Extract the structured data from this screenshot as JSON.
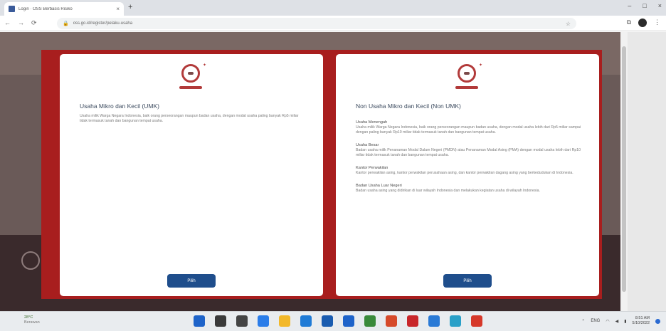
{
  "browser": {
    "tab_title": "Login · OSS Berbasis Risiko",
    "tab_close": "×",
    "new_tab": "+",
    "window_controls": [
      "–",
      "□",
      "×"
    ],
    "nav_controls": [
      "←",
      "→",
      "⟳"
    ],
    "url": "oss.go.id/register/pelaku-usaha",
    "secure_icon": "lock-icon"
  },
  "modal": {
    "left_card": {
      "title": "Usaha Mikro dan Kecil (UMK)",
      "description": "Usaha milik Warga Negara Indonesia, baik orang perseorangan maupun badan usaha, dengan modal usaha paling banyak Rp5 miliar tidak termasuk tanah dan bangunan tempat usaha.",
      "button": "Pilih"
    },
    "right_card": {
      "title": "Non Usaha Mikro dan Kecil (Non UMK)",
      "sections": [
        {
          "title": "Usaha Menengah",
          "text": "Usaha milik Warga Negara Indonesia, baik orang perseorangan maupun badan usaha, dengan modal usaha lebih dari Rp5 miliar sampai dengan paling banyak Rp10 miliar tidak termasuk tanah dan bangunan tempat usaha."
        },
        {
          "title": "Usaha Besar",
          "text": "Badan usaha milik Penanaman Modal Dalam Negeri (PMDN) atau Penanaman Modal Asing (PMA) dengan modal usaha lebih dari Rp10 miliar tidak termasuk tanah dan bangunan tempat usaha."
        },
        {
          "title": "Kantor Perwakilan",
          "text": "Kantor perwakilan asing, kantor perwakilan perusahaan asing, dan kantor perwakilan dagang asing yang berkedudukan di Indonesia."
        },
        {
          "title": "Badan Usaha Luar Negeri",
          "text": "Badan usaha asing yang didirikan di luar wilayah Indonesia dan melakukan kegiatan usaha di wilayah Indonesia."
        }
      ],
      "button": "Pilih"
    }
  },
  "taskbar": {
    "weather_temp": "28°C",
    "weather_desc": "Berawan",
    "tray_lang": "ENG",
    "time": "8:51 AM",
    "date": "5/10/2022",
    "app_colors": [
      "#1e63c9",
      "#3a3a3a",
      "#444444",
      "#2b7de9",
      "#f2b82a",
      "#1f7bd6",
      "#1a5cb0",
      "#1e63c9",
      "#3a8a3a",
      "#d64a2a",
      "#c8262a",
      "#2a7ad6",
      "#2aa0c8",
      "#d6382a"
    ]
  },
  "colors": {
    "overlay_red": "#a81e1e",
    "button_blue": "#1f4e8c",
    "title_text": "#3b4a5e"
  }
}
